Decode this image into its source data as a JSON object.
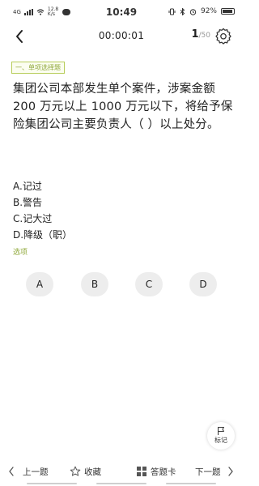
{
  "status_bar": {
    "network": "4G",
    "speed": "12.8 K/s",
    "time": "10:49",
    "battery": "92%"
  },
  "header": {
    "timer": "00:00:01",
    "current": "1",
    "total": "/50"
  },
  "question": {
    "type_label": "一、单项选择题",
    "text": "集团公司本部发生单个案件，涉案金额 200 万元以上 1000 万元以下，将给予保险集团公司主要负责人（ ）以上处分。",
    "options": [
      "A.记过",
      "B.警告",
      "C.记大过",
      "D.降级（职）"
    ],
    "options_label": "选项",
    "choices": [
      "A",
      "B",
      "C",
      "D"
    ]
  },
  "mark": {
    "label": "标记"
  },
  "bottom_bar": {
    "prev": "上一题",
    "favorite": "收藏",
    "answer_card": "答题卡",
    "next": "下一题"
  },
  "colors": {
    "accent": "#8fa83a",
    "choice_bg": "#ededed"
  }
}
